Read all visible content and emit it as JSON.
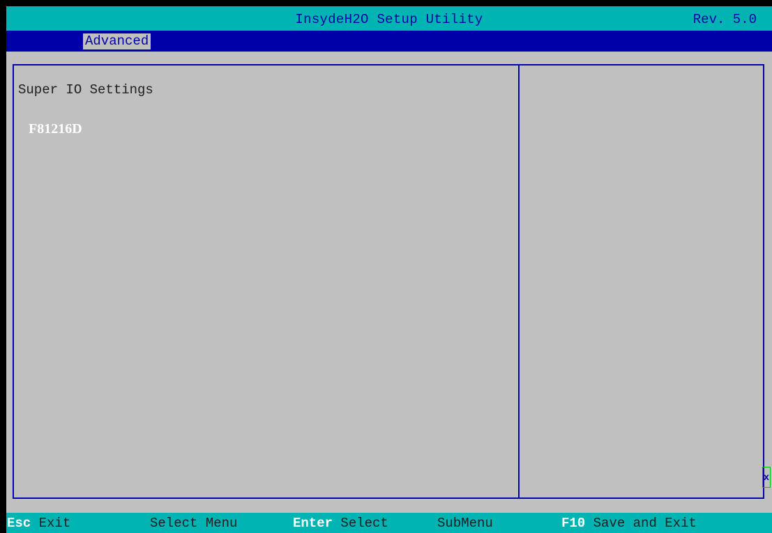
{
  "title_bar": {
    "title": "InsydeH2O Setup Utility",
    "revision": "Rev. 5.0"
  },
  "menu": {
    "active_tab": "Advanced"
  },
  "main": {
    "section_title": "Super IO Settings",
    "items": [
      {
        "label": "F81216D"
      }
    ]
  },
  "scroll_indicator": "x",
  "footer": {
    "esc_key": "Esc",
    "esc_label": "Exit",
    "select_menu": "Select Menu",
    "enter_key": "Enter",
    "enter_label": "Select",
    "submenu": "SubMenu",
    "f10_key": "F10",
    "f10_label": "Save and Exit"
  },
  "colors": {
    "background": "#c0c0c0",
    "bar": "#00b4b4",
    "menu_bar": "#0000a8",
    "frame": "#0000a8",
    "highlight_text": "#ffffff"
  }
}
